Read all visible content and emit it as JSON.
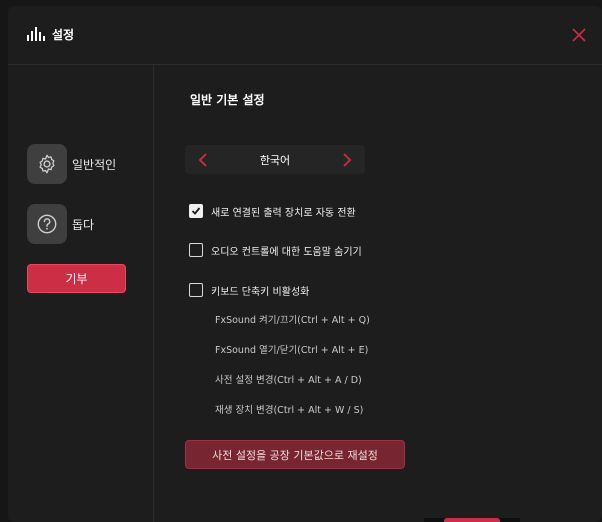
{
  "window": {
    "title": "설정"
  },
  "sidebar": {
    "items": [
      {
        "label": "일반적인",
        "icon": "gear-icon"
      },
      {
        "label": "돕다",
        "icon": "question-icon"
      }
    ],
    "donate_label": "기부"
  },
  "main": {
    "section_title": "일반 기본 설정",
    "language": {
      "value": "한국어"
    },
    "options": [
      {
        "label": "새로 연결된 출력 장치로 자동 전환",
        "checked": true
      },
      {
        "label": "오디오 컨트롤에 대한 도움말 숨기기",
        "checked": false
      },
      {
        "label": "키보드 단축키 비활성화",
        "checked": false
      }
    ],
    "shortcuts": [
      "FxSound 켜기/끄기(Ctrl + Alt + Q)",
      "FxSound 열기/닫기(Ctrl + Alt + E)",
      "사전 설정 변경(Ctrl + Alt + A / D)",
      "재생 장치 변경(Ctrl + Alt + W / S)"
    ],
    "reset_label": "사전 설정을 공장 기본값으로 재설정"
  },
  "colors": {
    "accent": "#cc2f45",
    "background": "#1d1d1d",
    "panel": "#252525"
  }
}
